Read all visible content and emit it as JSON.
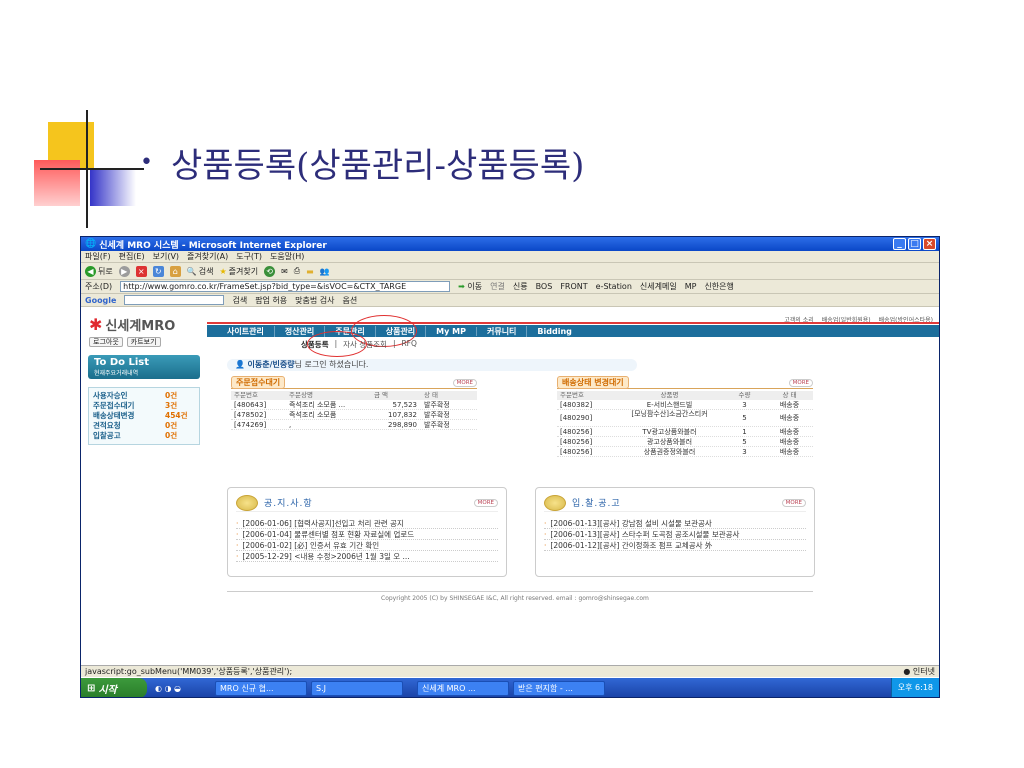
{
  "slide": {
    "bullet": "•",
    "title": "상품등록(상품관리-상품등록)"
  },
  "window": {
    "title": "신세계 MRO 시스템 - Microsoft Internet Explorer",
    "menu": [
      "파일(F)",
      "편집(E)",
      "보기(V)",
      "즐겨찾기(A)",
      "도구(T)",
      "도움말(H)"
    ],
    "toolbar": {
      "back": "뒤로",
      "search": "검색",
      "favorites": "즐겨찾기"
    },
    "address_label": "주소(D)",
    "address": "http://www.gomro.co.kr/FrameSet.jsp?bid_type=&isVOC=&CTX_TARGE",
    "go_label": "이동",
    "links_label": "연결",
    "links": [
      "신룡",
      "BOS",
      "FRONT",
      "e-Station",
      "신세계메일",
      "MP",
      "신한은행"
    ],
    "google_label": "Google",
    "google_items": [
      "검색",
      "팝업 허용",
      "맞춤법 검사",
      "옵션"
    ]
  },
  "site": {
    "logo": "신세계MRO",
    "logout": "로그아웃",
    "cart": "카트보기",
    "top_links": [
      "고객의 소리",
      "배송업(일반회원용)",
      "배송업(방인어스타용)"
    ],
    "nav": [
      "사이트관리",
      "정산관리",
      "주문관리",
      "상품관리",
      "My MP",
      "커뮤니티",
      "Bidding"
    ],
    "subnav": [
      "상품등록",
      "자사 상품조회",
      "RFQ"
    ],
    "todo_title": "To Do List",
    "todo_sub": "현재주요거래내역",
    "stats": [
      {
        "label": "사용자승인",
        "value": "0건"
      },
      {
        "label": "주문접수대기",
        "value": "3건"
      },
      {
        "label": "배송상태변경",
        "value": "454건"
      },
      {
        "label": "견적요청",
        "value": "0건"
      },
      {
        "label": "입찰공고",
        "value": "0건"
      }
    ],
    "welcome_name": "이동춘/빈중량",
    "welcome_text": "님 로그인 하셨습니다.",
    "orders": {
      "title": "주문접수대기",
      "more": "MORE",
      "headers": [
        "주문번호",
        "주문상명",
        "금 액",
        "상 태"
      ],
      "rows": [
        [
          "[480643]",
          "즉석조리 소모품 ...",
          "57,523",
          "발주확정"
        ],
        [
          "[478502]",
          "즉석조리 소모품",
          "107,832",
          "발주확정"
        ],
        [
          "[474269]",
          ",",
          "298,890",
          "발주확정"
        ]
      ]
    },
    "delivery": {
      "title": "배송상태 변경대기",
      "more": "MORE",
      "headers": [
        "주문번호",
        "상품명",
        "수량",
        "상 태"
      ],
      "rows": [
        [
          "[480382]",
          "E-서비스핸드빌",
          "3",
          "배송중"
        ],
        [
          "[480290]",
          "[모닝팜수산]소금간스티커",
          "5",
          "배송중"
        ],
        [
          "[480256]",
          "TV광고상품와블러",
          "1",
          "배송중"
        ],
        [
          "[480256]",
          "광고상품와블러",
          "5",
          "배송중"
        ],
        [
          "[480256]",
          "상품권증정와블러",
          "3",
          "배송중"
        ]
      ]
    },
    "notice": {
      "title": "공.지.사.항",
      "more": "MORE",
      "items": [
        "[2006-01-06] [협력사공지]선입고 처리 관련 공지",
        "[2006-01-04] 물류센터별 점포 현황 자료실에 업로드",
        "[2006-01-02] [必] 인증서 유효 기간 확인",
        "[2005-12-29] <내용 수정>2006년 1월 3일 오 ..."
      ]
    },
    "bid": {
      "title": "입.찰.공.고",
      "more": "MORE",
      "items": [
        "[2006-01-13][공사] 강남점 설비 시설물 보관공사",
        "[2006-01-13][공사] 스타수퍼 도곡점 공조시설물 보관공사",
        "[2006-01-12][공사] 간이정화조 펌프 교체공사 外"
      ]
    },
    "copyright": "Copyright 2005 (C) by SHINSEGAE I&C, All right reserved. email : gomro@shinsegae.com"
  },
  "status": {
    "text": "javascript:go_subMenu('MM039','상품등록','상품관리');",
    "zone": "인터넷"
  },
  "taskbar": {
    "start": "시작",
    "tasks": [
      "MRO 신규 협...",
      "S.J",
      "신세계 MRO ...",
      "받은 편지함 - ..."
    ],
    "clock": "오후 6:18"
  }
}
